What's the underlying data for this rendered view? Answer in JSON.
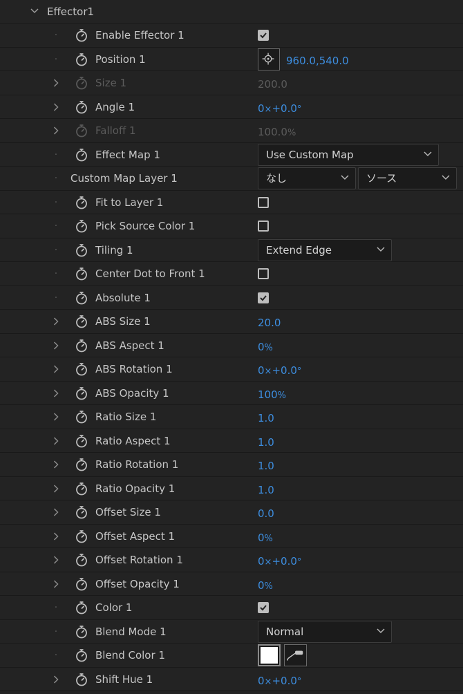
{
  "group": {
    "title": "Effector1"
  },
  "rows": [
    {
      "label": "Enable Effector 1",
      "twirl": "dot",
      "control": "check",
      "checked": true
    },
    {
      "label": "Position 1",
      "twirl": "dot",
      "control": "position",
      "value": "960.0,540.0"
    },
    {
      "label": "Size 1",
      "twirl": "arrow",
      "control": "value",
      "value": "200.0",
      "disabled": true
    },
    {
      "label": "Angle 1",
      "twirl": "arrow",
      "control": "angle",
      "rev": "0",
      "deg": "+0.0"
    },
    {
      "label": "Falloff 1",
      "twirl": "arrow",
      "control": "value",
      "value": "100.0",
      "suffix": "%",
      "disabled": true
    },
    {
      "label": "Effect Map 1",
      "twirl": "dot",
      "control": "dropdown",
      "value": "Use Custom Map",
      "width": 262
    },
    {
      "label": "Custom Map Layer 1",
      "twirl": "dot",
      "control": "layer",
      "nostopwatch": true,
      "layer": "なし",
      "source": "ソース"
    },
    {
      "label": "Fit to Layer 1",
      "twirl": "dot",
      "control": "check",
      "checked": false
    },
    {
      "label": "Pick Source Color 1",
      "twirl": "dot",
      "control": "check",
      "checked": false
    },
    {
      "label": "Tiling 1",
      "twirl": "dot",
      "control": "dropdown",
      "value": "Extend Edge",
      "width": 194
    },
    {
      "label": "Center Dot to Front 1",
      "twirl": "dot",
      "control": "check",
      "checked": false
    },
    {
      "label": "Absolute 1",
      "twirl": "dot",
      "control": "check",
      "checked": true
    },
    {
      "label": "ABS Size 1",
      "twirl": "arrow",
      "control": "value",
      "value": "20.0"
    },
    {
      "label": "ABS Aspect 1",
      "twirl": "arrow",
      "control": "value",
      "value": "0",
      "suffix": "%"
    },
    {
      "label": "ABS Rotation 1",
      "twirl": "arrow",
      "control": "angle",
      "rev": "0",
      "deg": "+0.0"
    },
    {
      "label": "ABS Opacity 1",
      "twirl": "arrow",
      "control": "value",
      "value": "100",
      "suffix": "%"
    },
    {
      "label": "Ratio Size 1",
      "twirl": "arrow",
      "control": "value",
      "value": "1.0"
    },
    {
      "label": "Ratio Aspect 1",
      "twirl": "arrow",
      "control": "value",
      "value": "1.0"
    },
    {
      "label": "Ratio Rotation 1",
      "twirl": "arrow",
      "control": "value",
      "value": "1.0"
    },
    {
      "label": "Ratio Opacity 1",
      "twirl": "arrow",
      "control": "value",
      "value": "1.0"
    },
    {
      "label": "Offset Size 1",
      "twirl": "arrow",
      "control": "value",
      "value": "0.0"
    },
    {
      "label": "Offset Aspect 1",
      "twirl": "arrow",
      "control": "value",
      "value": "0",
      "suffix": "%"
    },
    {
      "label": "Offset Rotation 1",
      "twirl": "arrow",
      "control": "angle",
      "rev": "0",
      "deg": "+0.0"
    },
    {
      "label": "Offset Opacity 1",
      "twirl": "arrow",
      "control": "value",
      "value": "0",
      "suffix": "%"
    },
    {
      "label": "Color 1",
      "twirl": "dot",
      "control": "check",
      "checked": true
    },
    {
      "label": "Blend Mode 1",
      "twirl": "dot",
      "control": "dropdown",
      "value": "Normal",
      "width": 194
    },
    {
      "label": "Blend Color 1",
      "twirl": "dot",
      "control": "color",
      "color": "#ffffff"
    },
    {
      "label": "Shift Hue 1",
      "twirl": "arrow",
      "control": "angle",
      "rev": "0",
      "deg": "+0.0"
    }
  ],
  "colors": {
    "background": "#232323",
    "value_blue": "#3d8ee0",
    "label": "#c6c6c6"
  },
  "icons": {
    "stopwatch": "stopwatch-icon",
    "twirl": "chevron-right-icon",
    "dropdown": "chevron-down-icon",
    "position": "crosshair-icon",
    "eyedropper": "eyedropper-icon"
  }
}
